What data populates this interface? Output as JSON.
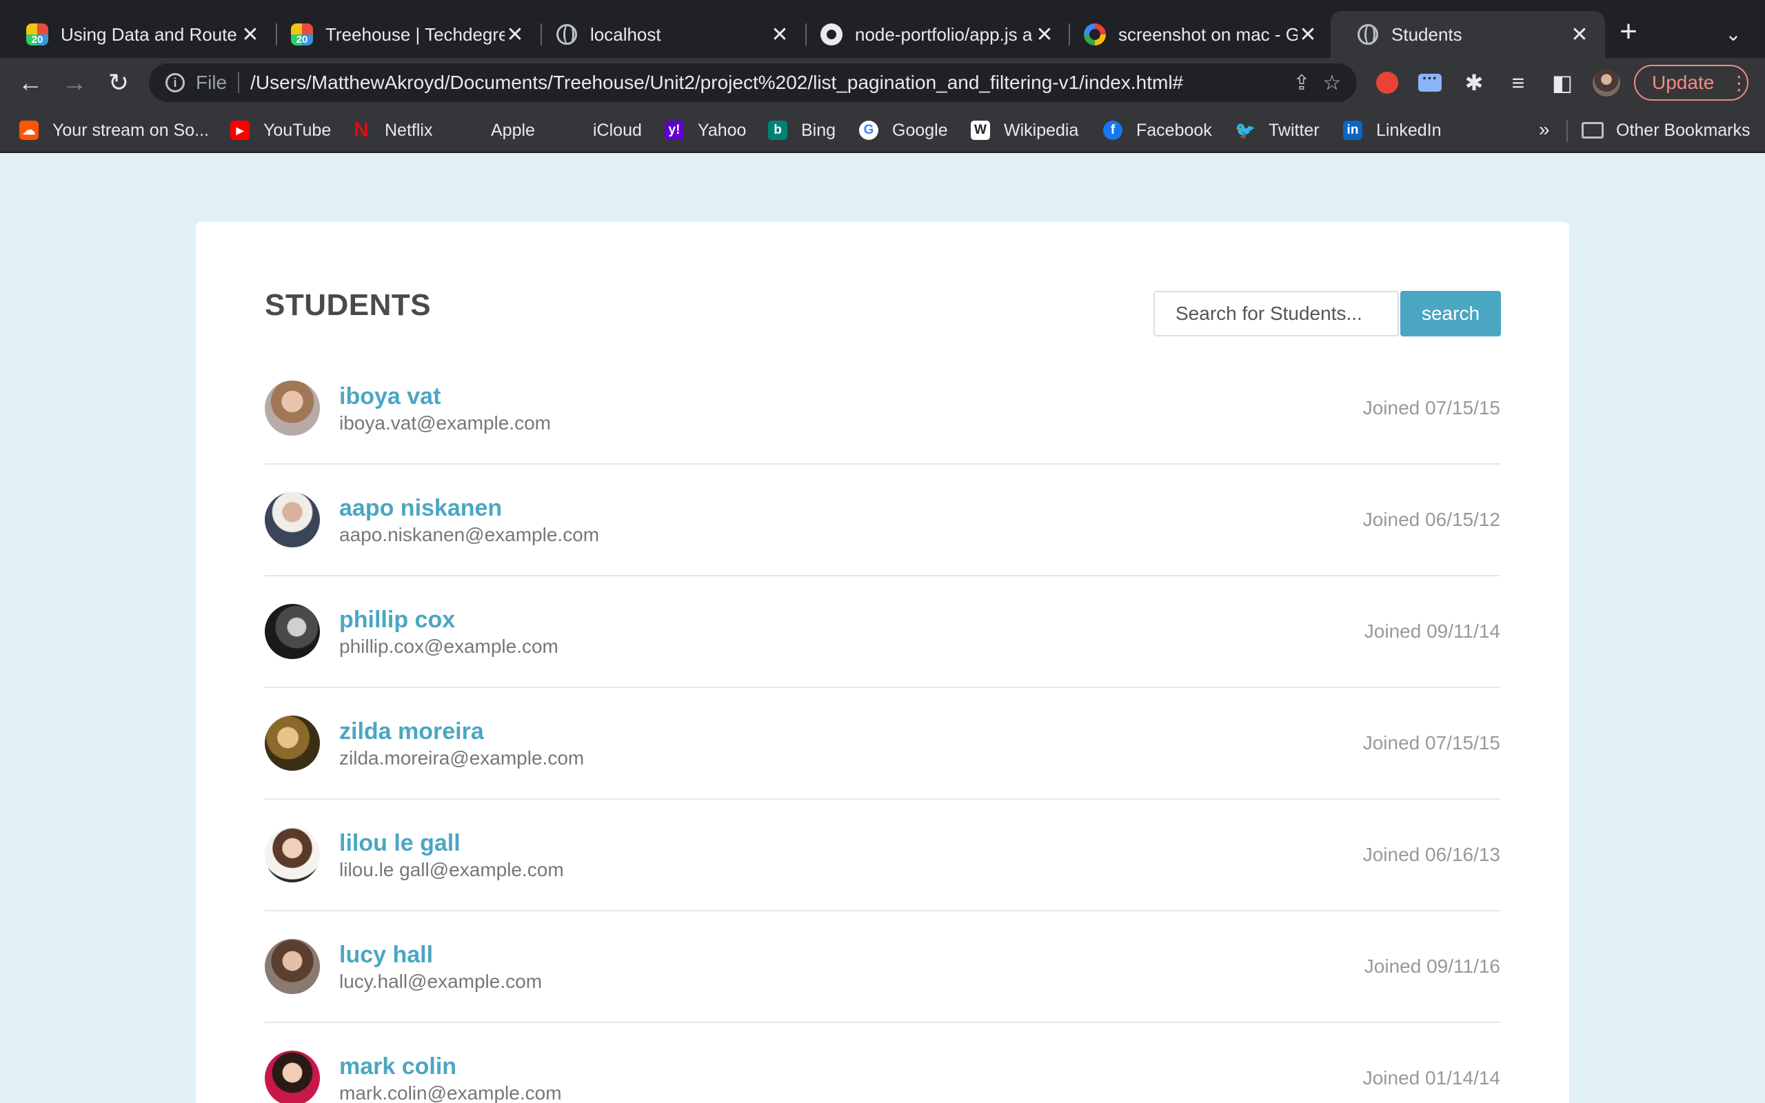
{
  "browser": {
    "tabs": [
      {
        "title": "Using Data and Route",
        "favicon": "treehouse-20-icon"
      },
      {
        "title": "Treehouse | Techdegre",
        "favicon": "treehouse-20-icon"
      },
      {
        "title": "localhost",
        "favicon": "globe-icon"
      },
      {
        "title": "node-portfolio/app.js a",
        "favicon": "github-icon"
      },
      {
        "title": "screenshot on mac - G",
        "favicon": "google-icon"
      },
      {
        "title": "Students",
        "favicon": "globe-icon",
        "active": true
      }
    ],
    "omnibox": {
      "scheme": "File",
      "url": "/Users/MatthewAkroyd/Documents/Treehouse/Unit2/project%202/list_pagination_and_filtering-v1/index.html#"
    },
    "update_label": "Update",
    "bookmarks": [
      {
        "label": "Your stream on So...",
        "icon": "soundcloud-icon",
        "color": "#ff5500"
      },
      {
        "label": "YouTube",
        "icon": "youtube-icon",
        "color": "#ff0000"
      },
      {
        "label": "Netflix",
        "icon": "netflix-icon",
        "color": "#e50914"
      },
      {
        "label": "Apple",
        "icon": "apple-icon",
        "color": "#9aa0a6"
      },
      {
        "label": "iCloud",
        "icon": "apple-icon",
        "color": "#9aa0a6"
      },
      {
        "label": "Yahoo",
        "icon": "yahoo-icon",
        "color": "#6001d2"
      },
      {
        "label": "Bing",
        "icon": "bing-icon",
        "color": "#008373"
      },
      {
        "label": "Google",
        "icon": "google-icon",
        "color": "#4285f4"
      },
      {
        "label": "Wikipedia",
        "icon": "wikipedia-icon",
        "color": "#ffffff"
      },
      {
        "label": "Facebook",
        "icon": "facebook-icon",
        "color": "#1877f2"
      },
      {
        "label": "Twitter",
        "icon": "twitter-icon",
        "color": "#1da1f2"
      },
      {
        "label": "LinkedIn",
        "icon": "linkedin-icon",
        "color": "#0a66c2"
      }
    ],
    "other_bookmarks_label": "Other Bookmarks",
    "more_bookmarks_label": "»"
  },
  "page": {
    "title": "STUDENTS",
    "search": {
      "placeholder": "Search for Students...",
      "value": "",
      "button_label": "search"
    },
    "accent_color": "#4ba6c3",
    "background_color": "#e1f0f4",
    "students": [
      {
        "name": "iboya vat",
        "email": "iboya.vat@example.com",
        "joined": "Joined 07/15/15"
      },
      {
        "name": "aapo niskanen",
        "email": "aapo.niskanen@example.com",
        "joined": "Joined 06/15/12"
      },
      {
        "name": "phillip cox",
        "email": "phillip.cox@example.com",
        "joined": "Joined 09/11/14"
      },
      {
        "name": "zilda moreira",
        "email": "zilda.moreira@example.com",
        "joined": "Joined 07/15/15"
      },
      {
        "name": "lilou le gall",
        "email": "lilou.le gall@example.com",
        "joined": "Joined 06/16/13"
      },
      {
        "name": "lucy hall",
        "email": "lucy.hall@example.com",
        "joined": "Joined 09/11/16"
      },
      {
        "name": "mark colin",
        "email": "mark.colin@example.com",
        "joined": "Joined 01/14/14"
      }
    ]
  }
}
